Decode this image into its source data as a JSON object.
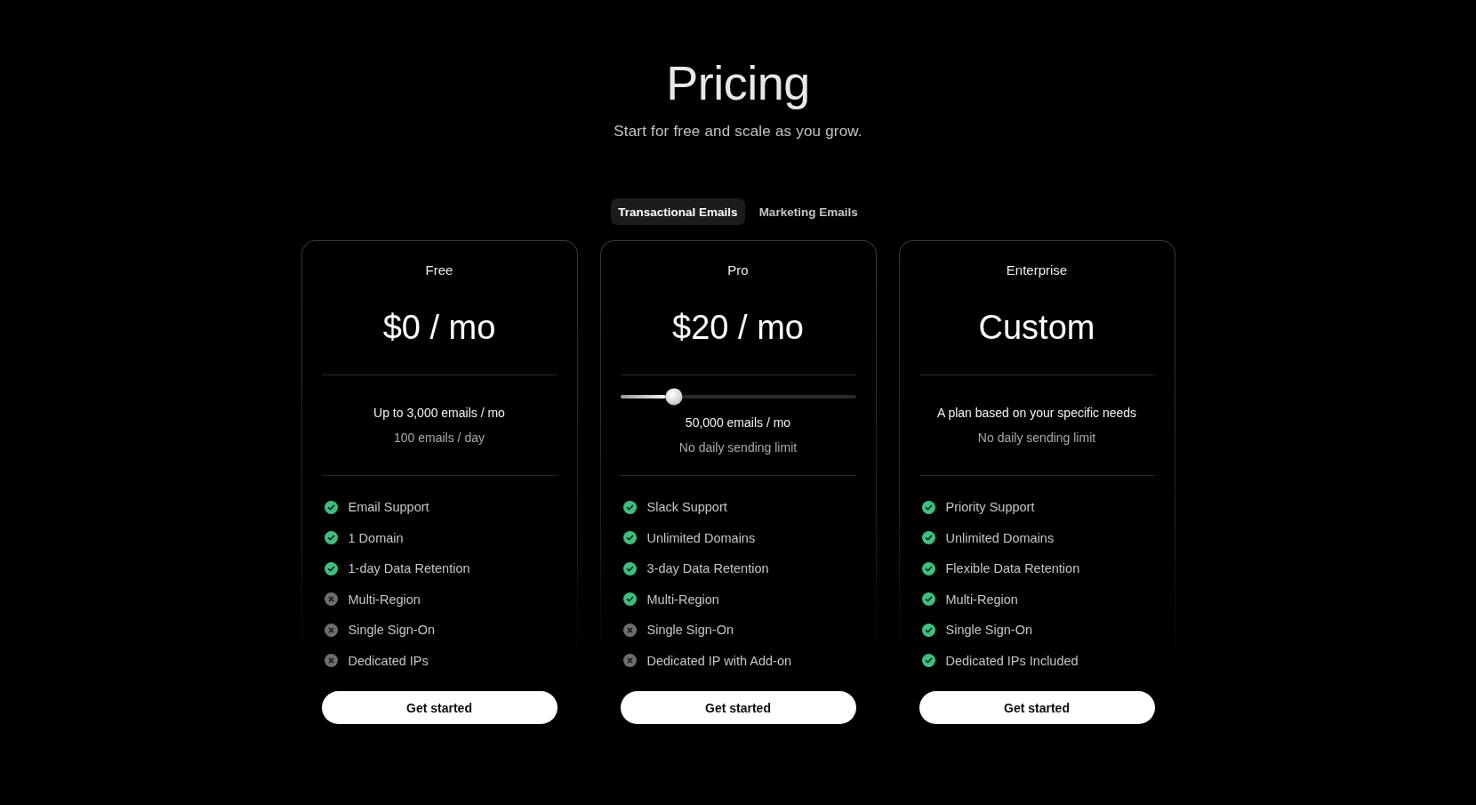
{
  "header": {
    "title": "Pricing",
    "subtitle": "Start for free and scale as you grow."
  },
  "tabs": [
    {
      "label": "Transactional Emails",
      "selected": true
    },
    {
      "label": "Marketing Emails",
      "selected": false
    }
  ],
  "plans": [
    {
      "name": "Free",
      "price": "$0 / mo",
      "allowance": {
        "kind": "text",
        "headline": "Up to 3,000 emails / mo",
        "detail": "100 emails / day"
      },
      "features": [
        {
          "label": "Email Support",
          "included": true
        },
        {
          "label": "1 Domain",
          "included": true
        },
        {
          "label": "1-day Data Retention",
          "included": true
        },
        {
          "label": "Multi-Region",
          "included": false
        },
        {
          "label": "Single Sign-On",
          "included": false
        },
        {
          "label": "Dedicated IPs",
          "included": false
        }
      ],
      "button": "Get started"
    },
    {
      "name": "Pro",
      "price": "$20 / mo",
      "allowance": {
        "kind": "slider",
        "level": 0.23,
        "headline": "50,000 emails / mo",
        "detail": "No daily sending limit"
      },
      "features": [
        {
          "label": "Slack Support",
          "included": true
        },
        {
          "label": "Unlimited Domains",
          "included": true
        },
        {
          "label": "3-day Data Retention",
          "included": true
        },
        {
          "label": "Multi-Region",
          "included": true
        },
        {
          "label": "Single Sign-On",
          "included": false
        },
        {
          "label": "Dedicated IP with Add-on",
          "included": false
        }
      ],
      "button": "Get started"
    },
    {
      "name": "Enterprise",
      "price": "Custom",
      "allowance": {
        "kind": "text",
        "headline": "A plan based on your specific needs",
        "detail": "No daily sending limit"
      },
      "features": [
        {
          "label": "Priority Support",
          "included": true
        },
        {
          "label": "Unlimited Domains",
          "included": true
        },
        {
          "label": "Flexible Data Retention",
          "included": true
        },
        {
          "label": "Multi-Region",
          "included": true
        },
        {
          "label": "Single Sign-On",
          "included": true
        },
        {
          "label": "Dedicated IPs Included",
          "included": true
        }
      ],
      "button": "Get started"
    }
  ]
}
